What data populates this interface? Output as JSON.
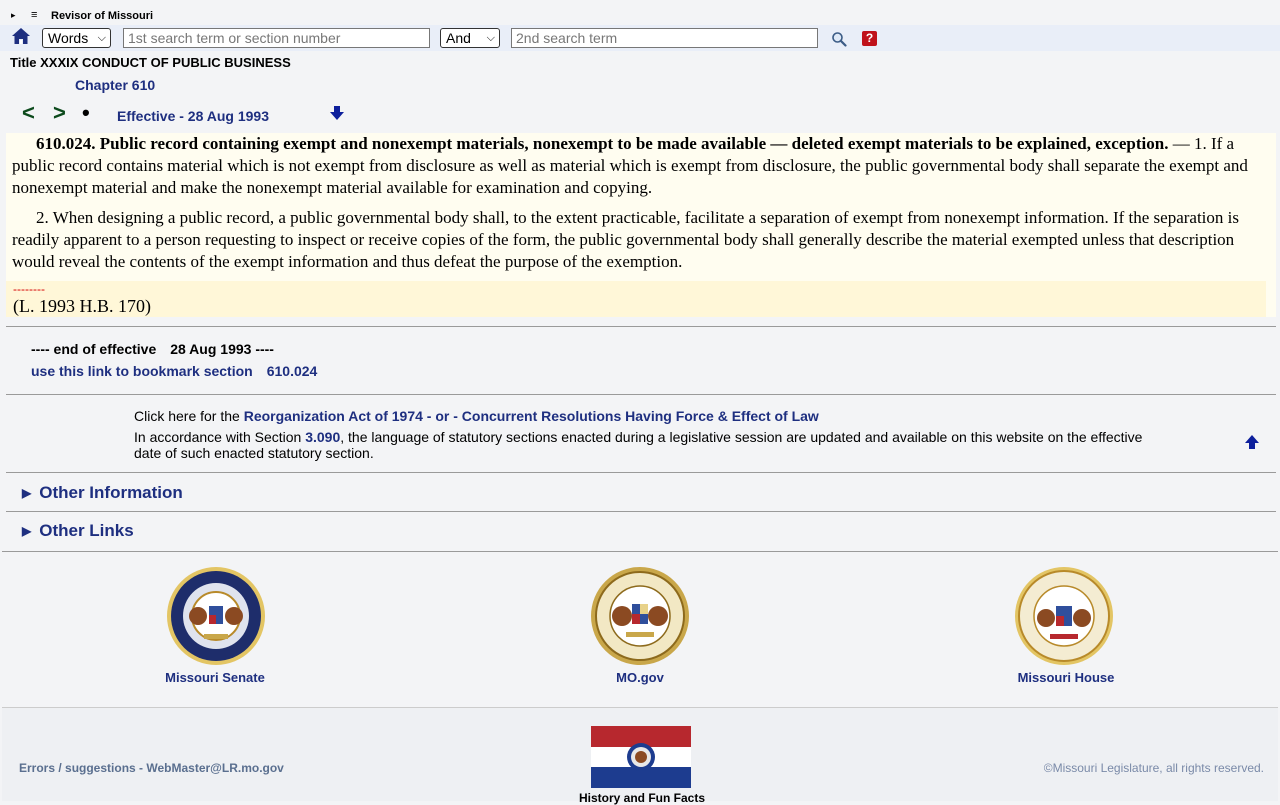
{
  "header": {
    "site_title": "Revisor of Missouri",
    "menu_glyph": "≡",
    "expand_glyph": "▸"
  },
  "search": {
    "mode_value": "Words",
    "term1_placeholder": "1st search term or section number",
    "operator_value": "And",
    "term2_placeholder": "2nd search term",
    "help_glyph": "?"
  },
  "breadcrumb": {
    "title": "Title XXXIX CONDUCT OF PUBLIC BUSINESS",
    "chapter": "Chapter 610"
  },
  "nav": {
    "prev": "<",
    "next": ">",
    "dot": "•",
    "effective": "Effective - 28 Aug 1993"
  },
  "law": {
    "section_heading": "610.024.  Public record containing exempt and nonexempt materials, nonexempt to be made available — deleted exempt materials to be explained, exception.",
    "para1": " — 1.  If a public record contains material which is not exempt from disclosure as well as material which is exempt from disclosure, the public governmental body shall separate the exempt and nonexempt material and make the nonexempt material available for examination and copying.",
    "para2": "2.  When designing a public record, a public governmental body shall, to the extent practicable, facilitate a separation of exempt from nonexempt information.  If the separation is readily apparent to a person requesting to inspect or receive copies of the form, the public governmental body shall generally describe the material exempted unless that description would reveal the contents of the exempt information and thus defeat the purpose of the exemption.",
    "history_dashes": "--------",
    "history": "(L. 1993 H.B. 170)"
  },
  "end": {
    "label": "---- end of effective",
    "date": "28 Aug 1993 ----",
    "bookmark_label": "use this link to bookmark section",
    "bookmark_section": "610.024"
  },
  "notice": {
    "click_prefix": "Click here for the ",
    "click_link": "Reorganization Act of 1974 - or - Concurrent Resolutions Having Force & Effect of Law",
    "accord_prefix": "In accordance with Section ",
    "accord_link": "3.090",
    "accord_suffix": ", the language of statutory sections enacted during a legislative session are updated and available on this website on the effective date of such enacted statutory section."
  },
  "sections": {
    "other_info": "Other Information",
    "other_links": "Other Links"
  },
  "seals": {
    "senate": "Missouri Senate",
    "mogov": "MO.gov",
    "house": "Missouri House"
  },
  "footer": {
    "errors": "Errors / suggestions - WebMaster@LR.mo.gov",
    "copyright": "©Missouri Legislature, all rights reserved.",
    "history_fun": "History and Fun Facts"
  },
  "colors": {
    "link_navy": "#1e2f80",
    "nav_green": "#0c4a1c",
    "help_red": "#c0121b",
    "flag_red": "#b7282e",
    "flag_blue": "#1d3c8f"
  }
}
